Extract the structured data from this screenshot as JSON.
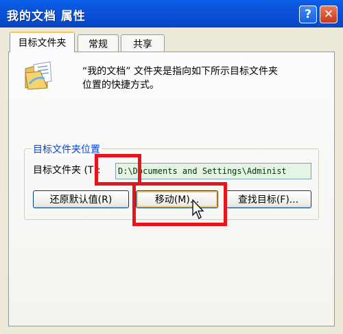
{
  "window": {
    "title": "我的文档 属性",
    "help_button": "?",
    "close_button": "✕"
  },
  "tabs": [
    {
      "label": "目标文件夹",
      "active": true
    },
    {
      "label": "常规",
      "active": false
    },
    {
      "label": "共享",
      "active": false
    }
  ],
  "description": {
    "line1": "“我的文档” 文件夹是指向如下所示目标文件夹",
    "line2": "位置的快捷方式。"
  },
  "group": {
    "legend": "目标文件夹位置",
    "target_label": "目标文件夹 (T):",
    "path_value": "D:\\Documents and Settings\\Administ"
  },
  "buttons": {
    "restore_default": "还原默认值(R)",
    "move": "移动(M)...",
    "find_target": "查找目标(F)..."
  },
  "colors": {
    "title_bar": "#0A52D8",
    "highlight": "#E8141C",
    "legend_text": "#0046D5"
  },
  "icons": {
    "folder": "folder-icon",
    "cursor": "mouse-pointer-icon"
  }
}
